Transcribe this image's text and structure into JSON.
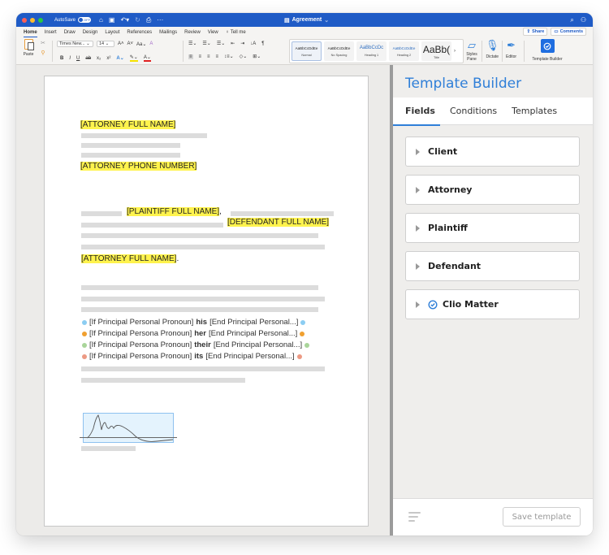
{
  "window": {
    "traffic_colors": [
      "#fe5f57",
      "#febc2e",
      "#28c840"
    ],
    "autosave_label": "AutoSave",
    "autosave_state": "OFF",
    "doc_title": "Agreement",
    "icons": [
      "home-icon",
      "save-icon",
      "undo-icon",
      "redo-icon",
      "print-icon",
      "more-icon"
    ]
  },
  "menu": {
    "tabs": [
      "Home",
      "Insert",
      "Draw",
      "Design",
      "Layout",
      "References",
      "Mailings",
      "Review",
      "View",
      "Tell me"
    ],
    "active": "Home",
    "share_label": "Share",
    "comments_label": "Comments"
  },
  "ribbon": {
    "paste_label": "Paste",
    "font_name": "Times New...",
    "font_size": "14",
    "styles": [
      {
        "sample": "AaBbCcDdEe",
        "name": "Normal"
      },
      {
        "sample": "AaBbCcDdEe",
        "name": "No Spacing"
      },
      {
        "sample": "AaBbCcDc",
        "name": "Heading 1"
      },
      {
        "sample": "AaBbCcDdEe",
        "name": "Heading 2"
      },
      {
        "sample": "AaBb(",
        "name": "Title"
      }
    ],
    "styles_pane_label": "Styles Pane",
    "dictate_label": "Dictate",
    "editor_label": "Editor",
    "template_builder_label": "Template Builder"
  },
  "document": {
    "attorney_full_name": "[ATTORNEY FULL NAME]",
    "attorney_phone": "[ATTORNEY PHONE NUMBER]",
    "plaintiff_full_name": "[PLAINTIFF FULL NAME]",
    "plaintiff_suffix": ",",
    "defendant_full_name": "[DEFENDANT FULL NAME]",
    "attorney_full_name_2": "[ATTORNEY FULL NAME]",
    "attorney_suffix": ".",
    "conditions": [
      {
        "prefix": "[If Principal Personal Pronoun]",
        "word": "his",
        "suffix": "[End Principal Personal...]",
        "color": "#8ccdf2"
      },
      {
        "prefix": "[If Principal Persona Pronoun]",
        "word": "her",
        "suffix": "[End Principal Personal...]",
        "color": "#f0a030"
      },
      {
        "prefix": "[If Principal Persona Pronoun]",
        "word": "their",
        "suffix": "[End Principal Personal...]",
        "color": "#a9d59a"
      },
      {
        "prefix": "[If Principal Persona Pronoun]",
        "word": "its",
        "suffix": "[End Principal Personal...]",
        "color": "#ec9a84"
      }
    ]
  },
  "panel": {
    "title": "Template Builder",
    "tabs": [
      "Fields",
      "Conditions",
      "Templates"
    ],
    "active_tab": "Fields",
    "fields": [
      "Client",
      "Attorney",
      "Plaintiff",
      "Defendant",
      "Clio Matter"
    ],
    "save_label": "Save template",
    "accent": "#2f7fd8"
  }
}
